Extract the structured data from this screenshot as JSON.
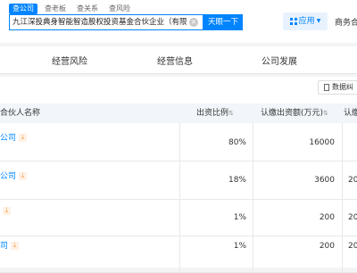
{
  "search": {
    "tabs": [
      "查公司",
      "查老板",
      "查关系",
      "查风险"
    ],
    "query": "九江深投典身智能智造股权投资基金合伙企业（有限合",
    "button": "天眼一下"
  },
  "header": {
    "app_label": "应用",
    "biz_label": "商务合"
  },
  "nav": {
    "items": [
      "经营风险",
      "经营信息",
      "公司发展"
    ]
  },
  "toolbar": {
    "export_label": "数据纠"
  },
  "table": {
    "columns": [
      "合伙人名称",
      "出资比例",
      "认缴出资额(万元)",
      "认缴"
    ],
    "rows": [
      {
        "name": "公司",
        "ratio": "80%",
        "amount": "16000",
        "extra": ""
      },
      {
        "name": "公司",
        "ratio": "18%",
        "amount": "3600",
        "extra": "20"
      },
      {
        "name": "",
        "ratio": "1%",
        "amount": "200",
        "extra": "20"
      },
      {
        "name": "司",
        "ratio": "1%",
        "amount": "200",
        "extra": "20"
      }
    ]
  },
  "colors": {
    "accent": "#0084ff",
    "tag": "#ff7a00"
  }
}
